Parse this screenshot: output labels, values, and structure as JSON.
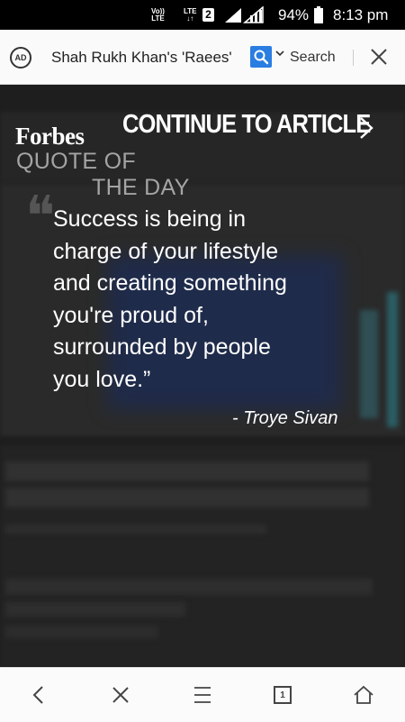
{
  "status_bar": {
    "volte_top": "Vo))",
    "volte_bottom": "LTE",
    "lte_top": "LTE",
    "lte_bottom": "↓↑",
    "sim_slot": "2",
    "battery": "94%",
    "time": "8:13 pm"
  },
  "browser": {
    "adblock_icon_text": "AD",
    "url_text": "Shah Rukh Khan's 'Raees'",
    "search_label": "Search",
    "accent_color": "#2a7de1"
  },
  "interstitial": {
    "logo": "Forbes",
    "continue_label": "CONTINUE TO ARTICLE",
    "label_line1": "QUOTE OF",
    "label_line2": "THE DAY",
    "quote_mark": "❝",
    "quote_lines": [
      "Success is being in",
      "charge of your lifestyle",
      "and creating something",
      "you're proud of,",
      "surrounded by people",
      "you love.”"
    ],
    "author": "- Troye Sivan"
  },
  "bottom_nav": {
    "tab_count": "1"
  }
}
